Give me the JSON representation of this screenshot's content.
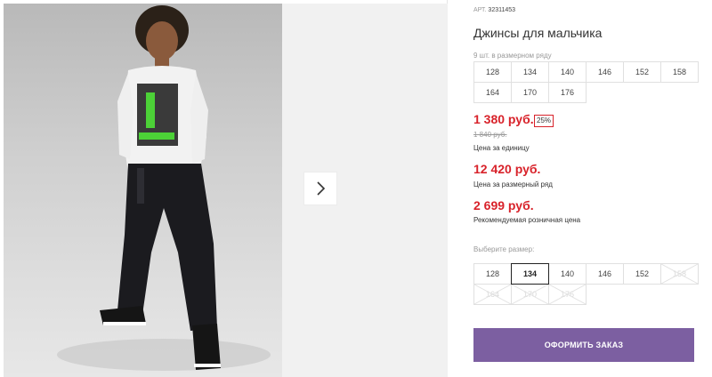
{
  "product": {
    "art_label": "АРТ.",
    "art_number": "32311453",
    "title": "Джинсы для мальчика",
    "pack_note": "9 шт. в размерном ряду",
    "pack_sizes": [
      "128",
      "134",
      "140",
      "146",
      "152",
      "158",
      "164",
      "170",
      "176"
    ],
    "price_unit": "1 380 руб.",
    "discount": "25%",
    "price_old": "1 840 руб.",
    "price_unit_caption": "Цена за единицу",
    "price_pack": "12 420 руб.",
    "price_pack_caption": "Цена за размерный ряд",
    "price_rrp": "2 699 руб.",
    "price_rrp_caption": "Рекомендуемая розничная цена",
    "choose_size_label": "Выберите размер:",
    "sizes": [
      {
        "label": "128",
        "state": "available"
      },
      {
        "label": "134",
        "state": "selected"
      },
      {
        "label": "140",
        "state": "available"
      },
      {
        "label": "146",
        "state": "available"
      },
      {
        "label": "152",
        "state": "available"
      },
      {
        "label": "158",
        "state": "disabled"
      },
      {
        "label": "164",
        "state": "disabled"
      },
      {
        "label": "170",
        "state": "disabled"
      },
      {
        "label": "176",
        "state": "disabled"
      }
    ],
    "order_button": "ОФОРМИТЬ ЗАКАЗ"
  },
  "gallery": {
    "next_icon": "chevron-right-icon"
  },
  "colors": {
    "price": "#d8222a",
    "order_button": "#7c5fa1",
    "disabled": "#d8d8d8"
  }
}
